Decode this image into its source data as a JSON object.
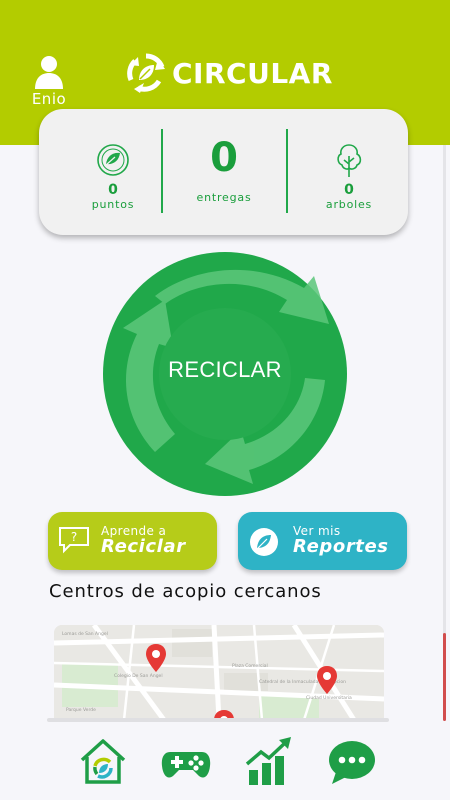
{
  "header": {
    "user_name": "Enio",
    "brand": "CIRCULAR"
  },
  "stats": {
    "points": {
      "value": "0",
      "label": "puntos"
    },
    "deliveries": {
      "value": "0",
      "label": "entregas"
    },
    "trees": {
      "value": "0",
      "label": "arboles"
    }
  },
  "recycle": {
    "label": "RECICLAR"
  },
  "actions": {
    "learn": {
      "small": "Aprende a",
      "big": "Reciclar",
      "icon": "question-bubble-icon"
    },
    "reports": {
      "small": "Ver mis",
      "big": "Reportes",
      "icon": "leaf-icon"
    }
  },
  "nearby": {
    "title": "Centros de acopio cercanos",
    "map_labels": [
      "Lomas de San Angel",
      "Colegio De San Angel",
      "Plaza Comercial",
      "Catedral de la Inmaculada Concepcion",
      "Ciudad Universitaria",
      "Parque Verde"
    ]
  },
  "tabs": [
    {
      "name": "home",
      "icon": "home-recycle-icon"
    },
    {
      "name": "games",
      "icon": "gamepad-icon"
    },
    {
      "name": "stats",
      "icon": "chart-growth-icon"
    },
    {
      "name": "chat",
      "icon": "chat-icon"
    }
  ],
  "colors": {
    "header": "#b3cc00",
    "primary_green": "#20a84a",
    "learn_button": "#b6cc19",
    "reports_button": "#2eb3c6",
    "pin": "#e53935"
  }
}
